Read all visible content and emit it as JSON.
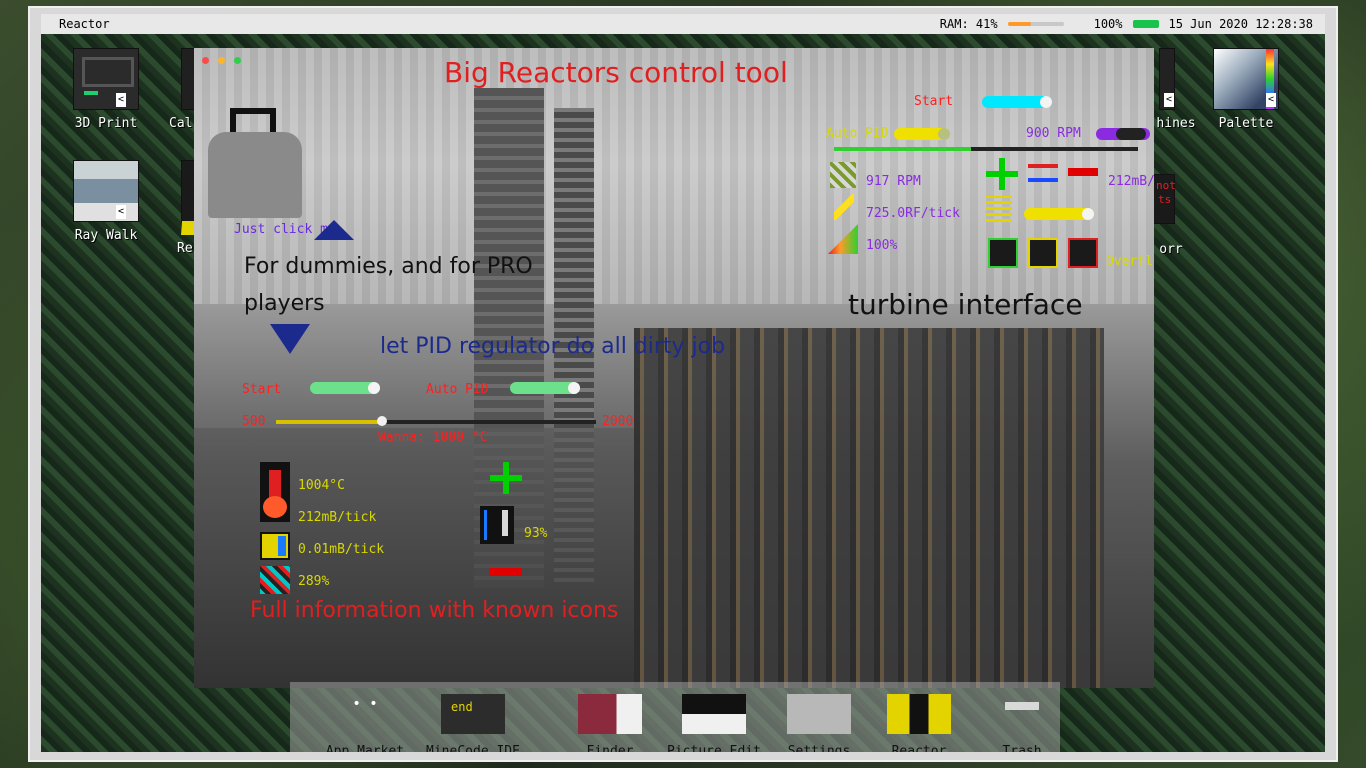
{
  "topbar": {
    "app_name": "Reactor",
    "ram_label": "RAM: 41%",
    "ram_percent": 41,
    "battery_label": "100%",
    "battery_percent": 100,
    "datetime": "15 Jun 2020 12:28:38"
  },
  "desktop_icons": [
    {
      "label": "3D Print",
      "icon": "3d-printer-icon"
    },
    {
      "label": "Cal",
      "icon": "calculator-icon"
    },
    {
      "label": "Ray Walk",
      "icon": "ray-walk-icon"
    },
    {
      "label": "Re",
      "icon": "reactor-icon"
    },
    {
      "label": "hines",
      "icon": "machines-icon"
    },
    {
      "label": "Palette",
      "icon": "palette-icon"
    },
    {
      "label": "orr",
      "icon": "unknown-icon"
    }
  ],
  "window": {
    "title": "Big Reactors control tool",
    "annotations": {
      "just_click": "Just click me",
      "dummies": "For dummies, and for PRO players",
      "pid": "let PID regulator do all dirty job",
      "turbine": "turbine interface",
      "full_info": "Full information with known icons"
    },
    "reactor": {
      "start_label": "Start",
      "auto_pid_label": "Auto PID",
      "temp_min": "500",
      "temp_max": "2000",
      "temp_target_label": "Wanna: 1000 °C",
      "temp_target_fraction": 0.33,
      "temperature": "1004°C",
      "steam": "212mB/tick",
      "fuel_usage": "0.01mB/tick",
      "reactivity": "289%",
      "rod_percent": "93%"
    },
    "turbine": {
      "start_label": "Start",
      "auto_pid_label": "Auto PID",
      "target_rpm": "900 RPM",
      "rpm": "917 RPM",
      "energy": "725.0RF/tick",
      "efficiency": "100%",
      "flow": "212mB/t",
      "overflow_label": "Overflow"
    }
  },
  "dock": [
    {
      "label": "App Market"
    },
    {
      "label": "MineCode IDE",
      "overlay": "end"
    },
    {
      "label": "Finder"
    },
    {
      "label": "Picture Edit"
    },
    {
      "label": "Settings"
    },
    {
      "label": "Reactor"
    },
    {
      "label": "Trash"
    }
  ],
  "colors": {
    "title_red": "#e02020",
    "label_blue": "#1b2a8c",
    "label_red": "#ff2020",
    "value_yellow": "#d8d800",
    "value_purple": "#8a2be2",
    "toggle_green": "#6ce08a",
    "toggle_cyan": "#00e8ff",
    "toggle_yellow": "#f0e000",
    "toggle_purple": "#8a2be2"
  }
}
